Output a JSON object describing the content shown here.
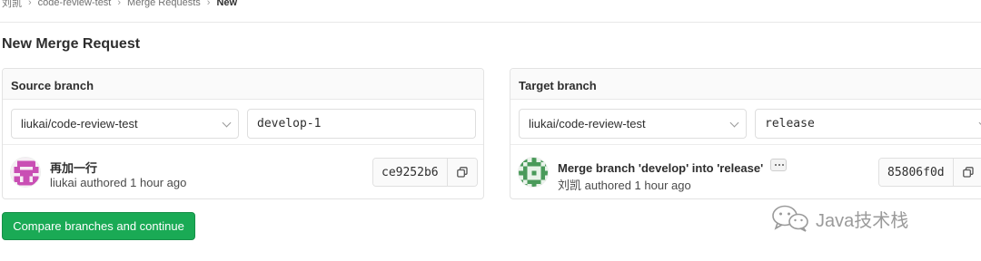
{
  "breadcrumb": {
    "items": [
      "刘凯",
      "code-review-test",
      "Merge Requests"
    ],
    "current": "New"
  },
  "page": {
    "title": "New Merge Request"
  },
  "source": {
    "heading": "Source branch",
    "project": "liukai/code-review-test",
    "branch": "develop-1",
    "commit": {
      "title": "再加一行",
      "meta": "liukai authored 1 hour ago",
      "sha": "ce9252b6"
    }
  },
  "target": {
    "heading": "Target branch",
    "project": "liukai/code-review-test",
    "branch": "release",
    "commit": {
      "title": "Merge branch 'develop' into 'release'",
      "meta": "刘凯 authored 1 hour ago",
      "sha": "85806f0d"
    }
  },
  "actions": {
    "compare_label": "Compare branches and continue"
  },
  "watermark": {
    "text": "Java技术栈"
  },
  "colors": {
    "primary_button": "#1aaa55",
    "avatar_source": "#c94fb4",
    "avatar_target": "#4a9a5a"
  },
  "icons": [
    "chevron-down-icon",
    "copy-icon",
    "ellipsis-icon",
    "wechat-icon"
  ]
}
